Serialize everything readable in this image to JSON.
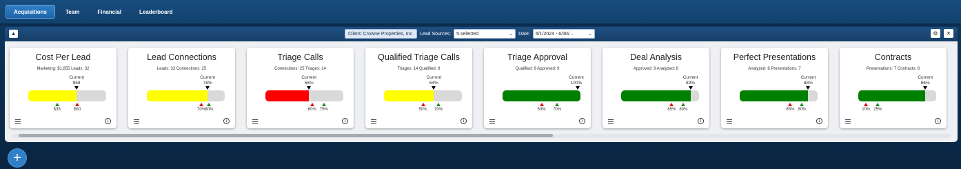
{
  "nav": {
    "tabs": [
      {
        "label": "Acquisitions",
        "active": true
      },
      {
        "label": "Team",
        "active": false
      },
      {
        "label": "Financial",
        "active": false
      },
      {
        "label": "Leaderboard",
        "active": false
      }
    ]
  },
  "filters": {
    "client": "Client: Crowne Properties, Inc.",
    "lead_sources_label": "Lead Sources:",
    "lead_sources_value": "5 selected",
    "date_label": "Date:",
    "date_value": "6/1/2024 - 6/30/..."
  },
  "cards": [
    {
      "title": "Cost Per Lead",
      "meta": "Marketing: $1,855   Leads: 32",
      "current_label": "Current",
      "current_value": "$58",
      "fill": 0.62,
      "fill_color": "#ffff00",
      "markers": [
        {
          "label": "$35",
          "color": "green",
          "pos": 0.37
        },
        {
          "label": "$60",
          "color": "red",
          "pos": 0.63
        }
      ]
    },
    {
      "title": "Lead Connections",
      "meta": "Leads: 32   Connections: 25",
      "current_label": "Current",
      "current_value": "78%",
      "fill": 0.78,
      "fill_color": "#ffff00",
      "markers": [
        {
          "label": "70%",
          "color": "red",
          "pos": 0.7
        },
        {
          "label": "80%",
          "color": "green",
          "pos": 0.8
        }
      ]
    },
    {
      "title": "Triage Calls",
      "meta": "Connections: 25   Triages: 14",
      "current_label": "Current",
      "current_value": "56%",
      "fill": 0.56,
      "fill_color": "#ff0000",
      "markers": [
        {
          "label": "60%",
          "color": "red",
          "pos": 0.6
        },
        {
          "label": "75%",
          "color": "green",
          "pos": 0.75
        }
      ]
    },
    {
      "title": "Qualified Triage Calls",
      "meta": "Triages: 14   Qualified: 9",
      "current_label": "Current",
      "current_value": "64%",
      "fill": 0.64,
      "fill_color": "#ffff00",
      "markers": [
        {
          "label": "50%",
          "color": "red",
          "pos": 0.5
        },
        {
          "label": "70%",
          "color": "green",
          "pos": 0.7
        }
      ]
    },
    {
      "title": "Triage Approval",
      "meta": "Qualified: 9   Approved: 9",
      "current_label": "Current",
      "current_value": "100%",
      "fill": 1.0,
      "fill_color": "#008000",
      "markers": [
        {
          "label": "50%",
          "color": "red",
          "pos": 0.5
        },
        {
          "label": "70%",
          "color": "green",
          "pos": 0.7
        }
      ]
    },
    {
      "title": "Deal Analysis",
      "meta": "Approved: 9   Analyzed: 8",
      "current_label": "Current",
      "current_value": "89%",
      "fill": 0.89,
      "fill_color": "#008000",
      "markers": [
        {
          "label": "65%",
          "color": "red",
          "pos": 0.65
        },
        {
          "label": "80%",
          "color": "green",
          "pos": 0.8
        }
      ]
    },
    {
      "title": "Perfect Presentations",
      "meta": "Analyzed: 8   Presentations: 7",
      "current_label": "Current",
      "current_value": "88%",
      "fill": 0.88,
      "fill_color": "#008000",
      "markers": [
        {
          "label": "65%",
          "color": "red",
          "pos": 0.65
        },
        {
          "label": "80%",
          "color": "green",
          "pos": 0.8
        }
      ]
    },
    {
      "title": "Contracts",
      "meta": "Presentations: 7   Contracts: 6",
      "current_label": "Current",
      "current_value": "86%",
      "fill": 0.86,
      "fill_color": "#008000",
      "markers": [
        {
          "label": "10%",
          "color": "red",
          "pos": 0.1
        },
        {
          "label": "25%",
          "color": "green",
          "pos": 0.25
        }
      ]
    }
  ],
  "icons": {
    "collapse": "chevron-up-icon",
    "settings": "gear-icon",
    "close": "close-icon",
    "list": "list-icon",
    "info": "info-icon",
    "add": "plus-icon"
  },
  "fab_label": "+"
}
